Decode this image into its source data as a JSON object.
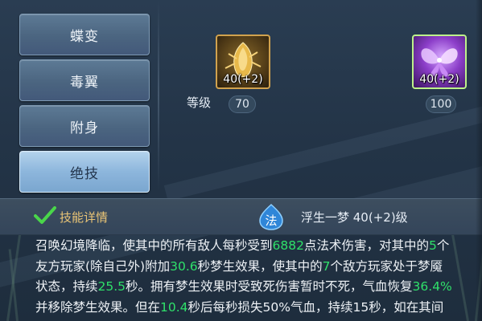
{
  "tabs": [
    {
      "label": "蝶变"
    },
    {
      "label": "毒翼"
    },
    {
      "label": "附身"
    },
    {
      "label": "绝技",
      "active": true
    }
  ],
  "items": [
    {
      "count": "40(+2)",
      "level": "70",
      "icon": "gold-crystal-icon"
    },
    {
      "count": "40(+2)",
      "level": "100",
      "icon": "purple-butterfly-icon"
    }
  ],
  "level_label": "等级",
  "skill_header": {
    "title": "技能详情",
    "check_icon": "green-check-icon",
    "school_badge": "法",
    "skill_name": "浮生一梦 40(+2)级"
  },
  "description": {
    "segments": [
      {
        "t": "召唤幻境降临，使其中的所有敌人每秒受到"
      },
      {
        "t": "6882",
        "hl": true
      },
      {
        "t": "点法术伤害，对其中的"
      },
      {
        "t": "5",
        "hl": true
      },
      {
        "t": "个友方玩家(除自己外)附加"
      },
      {
        "t": "30.6",
        "hl": true
      },
      {
        "t": "秒梦生效果，使其中的"
      },
      {
        "t": "7",
        "hl": true
      },
      {
        "t": "个敌方玩家处于梦魇状态，持续"
      },
      {
        "t": "25.5",
        "hl": true
      },
      {
        "t": "秒。拥有梦生效果时受致死伤害暂时不死，气血恢复"
      },
      {
        "t": "36.4%",
        "hl": true
      },
      {
        "t": "并移除梦生效果。但在"
      },
      {
        "t": "10.4",
        "hl": true
      },
      {
        "t": "秒后每秒损失50%气血，持续15秒，如在其间"
      }
    ]
  },
  "colors": {
    "highlight": "#2fe06a",
    "title_gold": "#e9c476",
    "active_tab": "#8db6dc"
  }
}
